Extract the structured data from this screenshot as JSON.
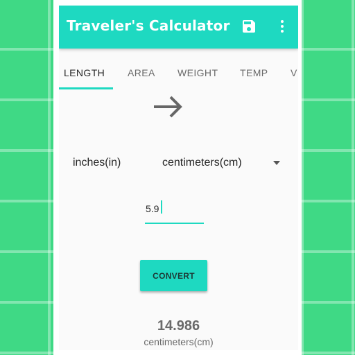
{
  "app_bar": {
    "title": "Traveler's Calculator",
    "actions": [
      "save-icon",
      "more-vert-icon"
    ]
  },
  "tabs": [
    {
      "label": "LENGTH",
      "active": true
    },
    {
      "label": "AREA",
      "active": false
    },
    {
      "label": "WEIGHT",
      "active": false
    },
    {
      "label": "TEMP",
      "active": false
    },
    {
      "label": "V",
      "active": false
    }
  ],
  "converter": {
    "from_unit": "inches(in)",
    "to_unit": "centimeters(cm)",
    "input_value": "5.9",
    "convert_label": "CONVERT",
    "arrow_icon": "arrow-right-icon",
    "dropdown_icon": "arrow-drop-down-icon"
  },
  "result": {
    "value": "14.986",
    "unit": "centimeters(cm)"
  },
  "colors": {
    "accent": "#1ed9c1",
    "background": "#3fd985"
  }
}
